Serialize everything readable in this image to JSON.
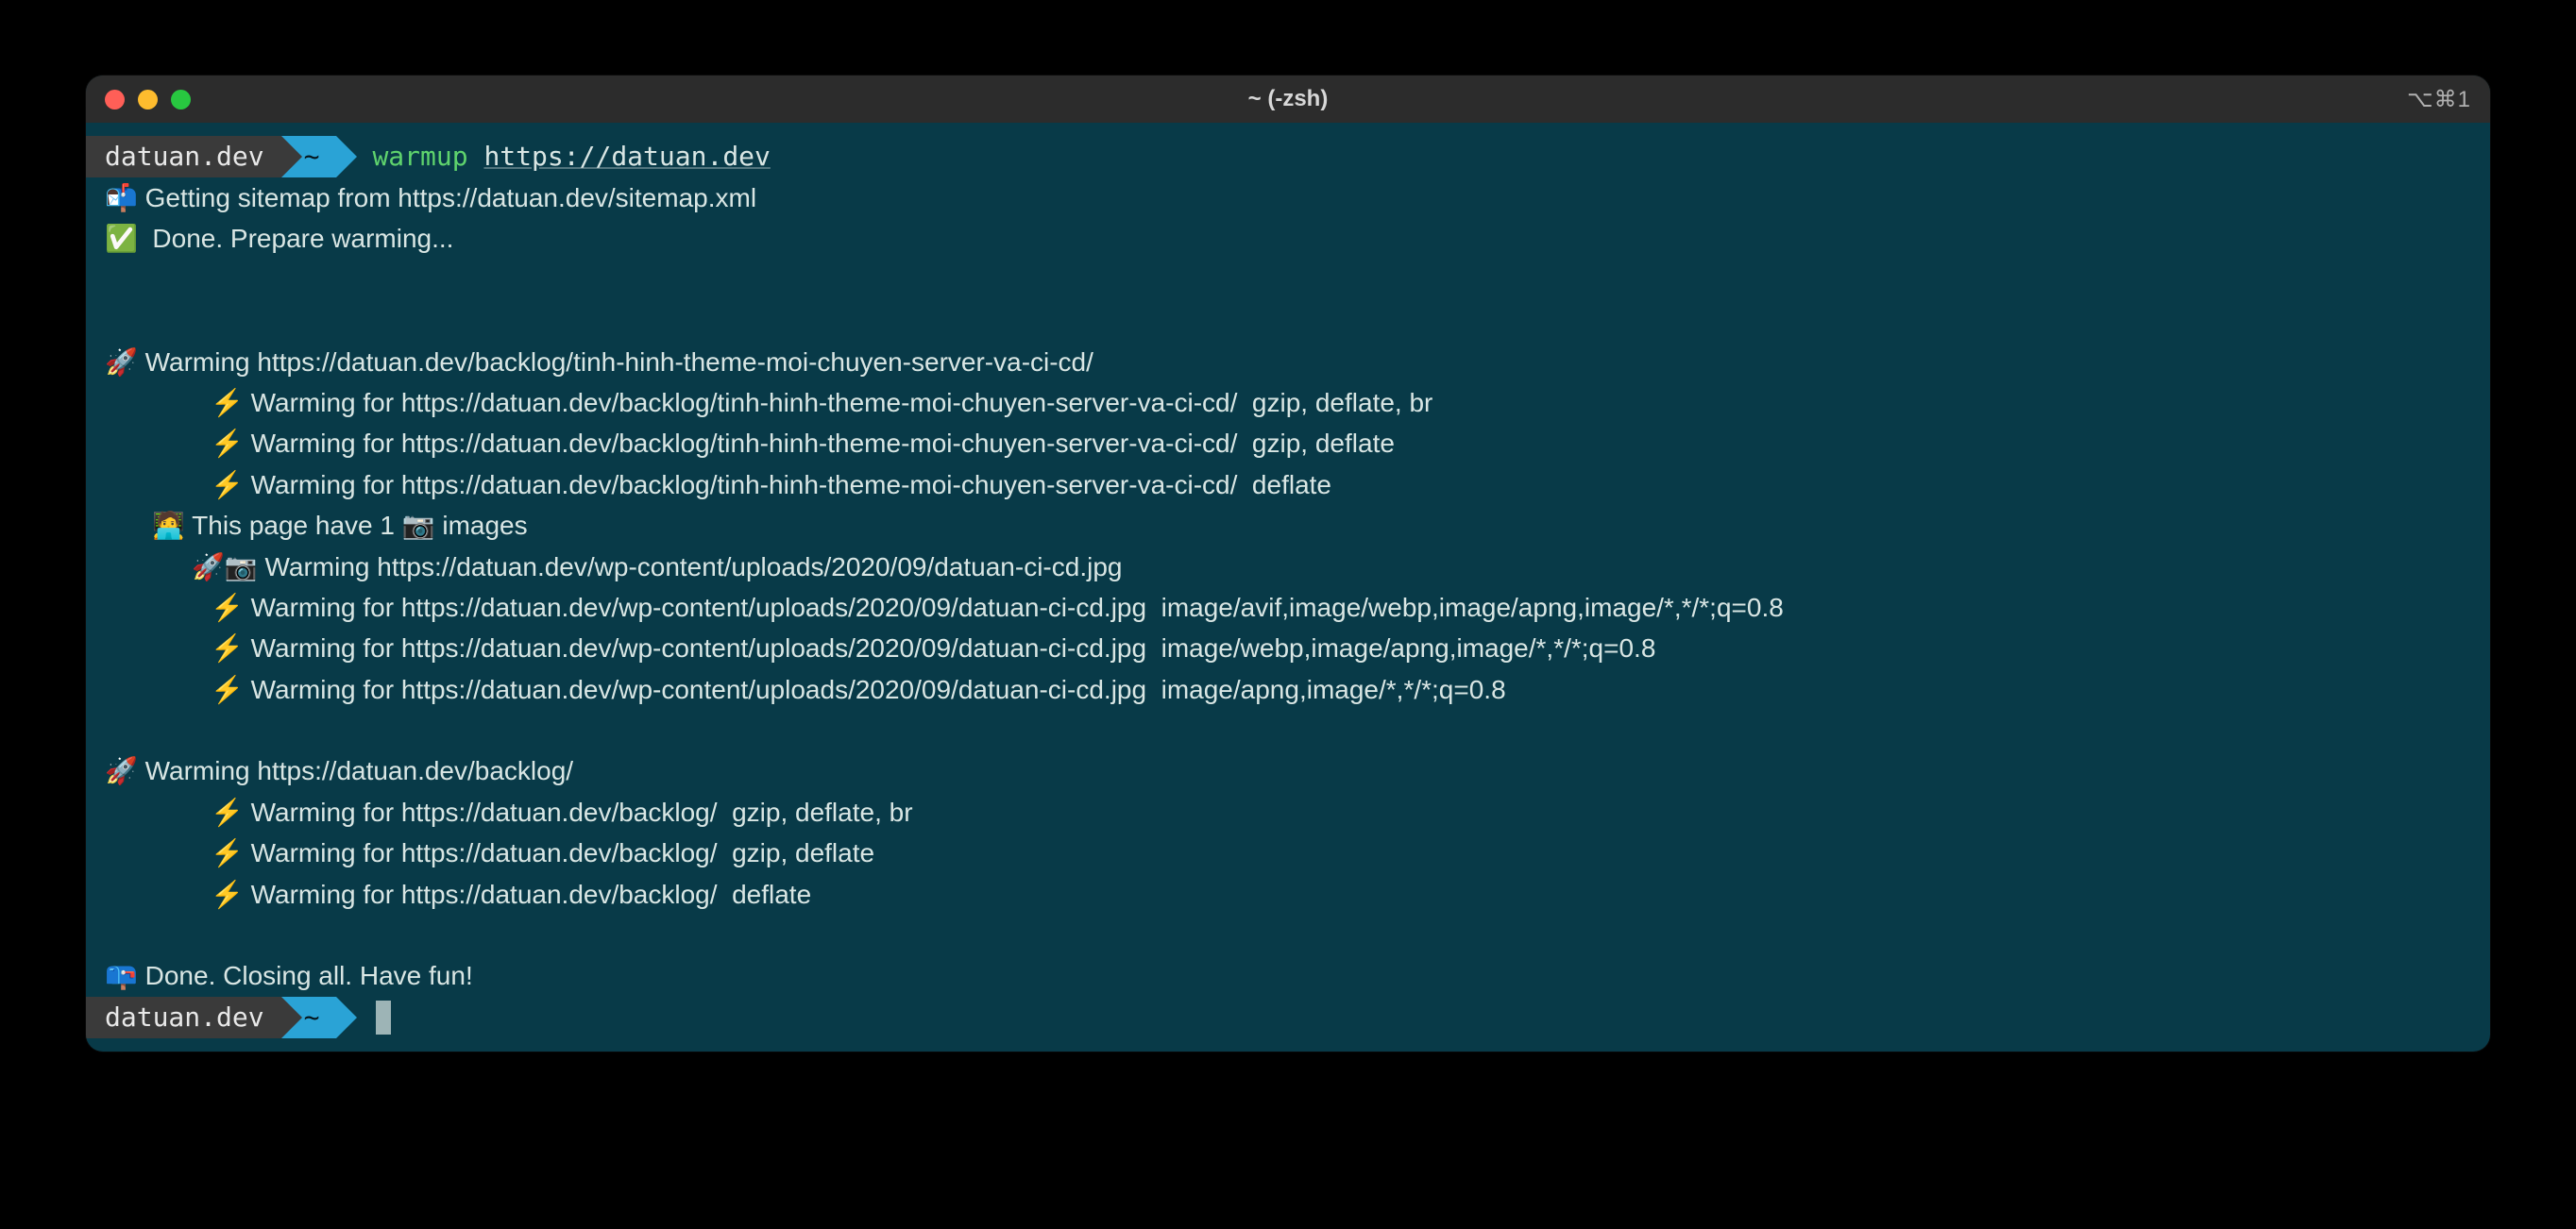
{
  "window": {
    "title": "~ (-zsh)",
    "shortcut_badge": "⌥⌘1"
  },
  "prompt1": {
    "host": " datuan.dev ",
    "dir": " ~ ",
    "cmd_name": "warmup",
    "cmd_arg": "https://datuan.dev"
  },
  "out": {
    "l01": "📬 Getting sitemap from https://datuan.dev/sitemap.xml",
    "l02": "✅  Done. Prepare warming...",
    "l03": "🚀 Warming https://datuan.dev/backlog/tinh-hinh-theme-moi-chuyen-server-va-ci-cd/",
    "l04": "⚡ Warming for https://datuan.dev/backlog/tinh-hinh-theme-moi-chuyen-server-va-ci-cd/  gzip, deflate, br",
    "l05": "⚡ Warming for https://datuan.dev/backlog/tinh-hinh-theme-moi-chuyen-server-va-ci-cd/  gzip, deflate",
    "l06": "⚡ Warming for https://datuan.dev/backlog/tinh-hinh-theme-moi-chuyen-server-va-ci-cd/  deflate",
    "l07": "🧑‍💻 This page have 1 📷 images",
    "l08": "🚀📷 Warming https://datuan.dev/wp-content/uploads/2020/09/datuan-ci-cd.jpg",
    "l09": "⚡ Warming for https://datuan.dev/wp-content/uploads/2020/09/datuan-ci-cd.jpg  image/avif,image/webp,image/apng,image/*,*/*;q=0.8",
    "l10": "⚡ Warming for https://datuan.dev/wp-content/uploads/2020/09/datuan-ci-cd.jpg  image/webp,image/apng,image/*,*/*;q=0.8",
    "l11": "⚡ Warming for https://datuan.dev/wp-content/uploads/2020/09/datuan-ci-cd.jpg  image/apng,image/*,*/*;q=0.8",
    "l12": "🚀 Warming https://datuan.dev/backlog/",
    "l13": "⚡ Warming for https://datuan.dev/backlog/  gzip, deflate, br",
    "l14": "⚡ Warming for https://datuan.dev/backlog/  gzip, deflate",
    "l15": "⚡ Warming for https://datuan.dev/backlog/  deflate",
    "l16": "📪 Done. Closing all. Have fun!"
  },
  "prompt2": {
    "host": " datuan.dev ",
    "dir": " ~ "
  }
}
